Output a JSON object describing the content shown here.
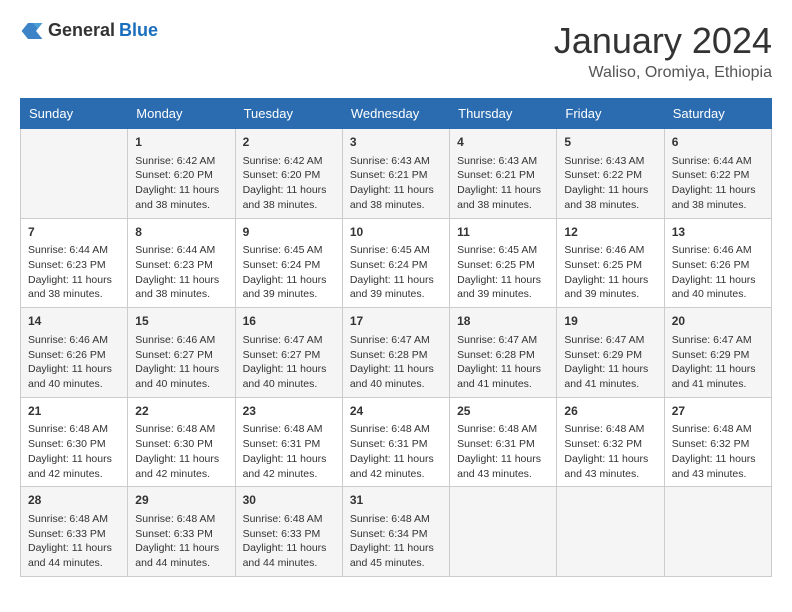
{
  "header": {
    "logo_general": "General",
    "logo_blue": "Blue",
    "month": "January 2024",
    "location": "Waliso, Oromiya, Ethiopia"
  },
  "days_of_week": [
    "Sunday",
    "Monday",
    "Tuesday",
    "Wednesday",
    "Thursday",
    "Friday",
    "Saturday"
  ],
  "weeks": [
    [
      {
        "day": "",
        "info": ""
      },
      {
        "day": "1",
        "info": "Sunrise: 6:42 AM\nSunset: 6:20 PM\nDaylight: 11 hours and 38 minutes."
      },
      {
        "day": "2",
        "info": "Sunrise: 6:42 AM\nSunset: 6:20 PM\nDaylight: 11 hours and 38 minutes."
      },
      {
        "day": "3",
        "info": "Sunrise: 6:43 AM\nSunset: 6:21 PM\nDaylight: 11 hours and 38 minutes."
      },
      {
        "day": "4",
        "info": "Sunrise: 6:43 AM\nSunset: 6:21 PM\nDaylight: 11 hours and 38 minutes."
      },
      {
        "day": "5",
        "info": "Sunrise: 6:43 AM\nSunset: 6:22 PM\nDaylight: 11 hours and 38 minutes."
      },
      {
        "day": "6",
        "info": "Sunrise: 6:44 AM\nSunset: 6:22 PM\nDaylight: 11 hours and 38 minutes."
      }
    ],
    [
      {
        "day": "7",
        "info": "Sunrise: 6:44 AM\nSunset: 6:23 PM\nDaylight: 11 hours and 38 minutes."
      },
      {
        "day": "8",
        "info": "Sunrise: 6:44 AM\nSunset: 6:23 PM\nDaylight: 11 hours and 38 minutes."
      },
      {
        "day": "9",
        "info": "Sunrise: 6:45 AM\nSunset: 6:24 PM\nDaylight: 11 hours and 39 minutes."
      },
      {
        "day": "10",
        "info": "Sunrise: 6:45 AM\nSunset: 6:24 PM\nDaylight: 11 hours and 39 minutes."
      },
      {
        "day": "11",
        "info": "Sunrise: 6:45 AM\nSunset: 6:25 PM\nDaylight: 11 hours and 39 minutes."
      },
      {
        "day": "12",
        "info": "Sunrise: 6:46 AM\nSunset: 6:25 PM\nDaylight: 11 hours and 39 minutes."
      },
      {
        "day": "13",
        "info": "Sunrise: 6:46 AM\nSunset: 6:26 PM\nDaylight: 11 hours and 40 minutes."
      }
    ],
    [
      {
        "day": "14",
        "info": "Sunrise: 6:46 AM\nSunset: 6:26 PM\nDaylight: 11 hours and 40 minutes."
      },
      {
        "day": "15",
        "info": "Sunrise: 6:46 AM\nSunset: 6:27 PM\nDaylight: 11 hours and 40 minutes."
      },
      {
        "day": "16",
        "info": "Sunrise: 6:47 AM\nSunset: 6:27 PM\nDaylight: 11 hours and 40 minutes."
      },
      {
        "day": "17",
        "info": "Sunrise: 6:47 AM\nSunset: 6:28 PM\nDaylight: 11 hours and 40 minutes."
      },
      {
        "day": "18",
        "info": "Sunrise: 6:47 AM\nSunset: 6:28 PM\nDaylight: 11 hours and 41 minutes."
      },
      {
        "day": "19",
        "info": "Sunrise: 6:47 AM\nSunset: 6:29 PM\nDaylight: 11 hours and 41 minutes."
      },
      {
        "day": "20",
        "info": "Sunrise: 6:47 AM\nSunset: 6:29 PM\nDaylight: 11 hours and 41 minutes."
      }
    ],
    [
      {
        "day": "21",
        "info": "Sunrise: 6:48 AM\nSunset: 6:30 PM\nDaylight: 11 hours and 42 minutes."
      },
      {
        "day": "22",
        "info": "Sunrise: 6:48 AM\nSunset: 6:30 PM\nDaylight: 11 hours and 42 minutes."
      },
      {
        "day": "23",
        "info": "Sunrise: 6:48 AM\nSunset: 6:31 PM\nDaylight: 11 hours and 42 minutes."
      },
      {
        "day": "24",
        "info": "Sunrise: 6:48 AM\nSunset: 6:31 PM\nDaylight: 11 hours and 42 minutes."
      },
      {
        "day": "25",
        "info": "Sunrise: 6:48 AM\nSunset: 6:31 PM\nDaylight: 11 hours and 43 minutes."
      },
      {
        "day": "26",
        "info": "Sunrise: 6:48 AM\nSunset: 6:32 PM\nDaylight: 11 hours and 43 minutes."
      },
      {
        "day": "27",
        "info": "Sunrise: 6:48 AM\nSunset: 6:32 PM\nDaylight: 11 hours and 43 minutes."
      }
    ],
    [
      {
        "day": "28",
        "info": "Sunrise: 6:48 AM\nSunset: 6:33 PM\nDaylight: 11 hours and 44 minutes."
      },
      {
        "day": "29",
        "info": "Sunrise: 6:48 AM\nSunset: 6:33 PM\nDaylight: 11 hours and 44 minutes."
      },
      {
        "day": "30",
        "info": "Sunrise: 6:48 AM\nSunset: 6:33 PM\nDaylight: 11 hours and 44 minutes."
      },
      {
        "day": "31",
        "info": "Sunrise: 6:48 AM\nSunset: 6:34 PM\nDaylight: 11 hours and 45 minutes."
      },
      {
        "day": "",
        "info": ""
      },
      {
        "day": "",
        "info": ""
      },
      {
        "day": "",
        "info": ""
      }
    ]
  ]
}
